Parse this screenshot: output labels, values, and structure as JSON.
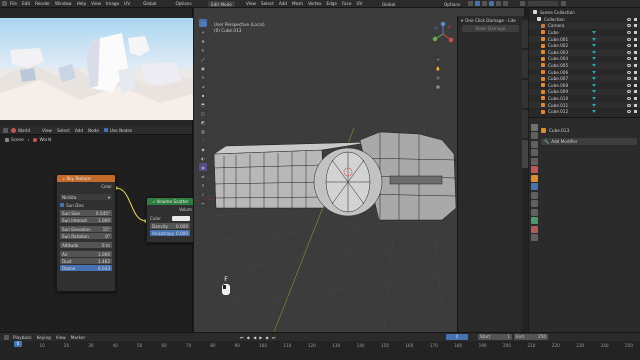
{
  "topbar": {
    "left_menus": [
      "File",
      "Edit",
      "Render",
      "Window",
      "Help"
    ],
    "left_editor_menus": [
      "View",
      "Image",
      "UV"
    ],
    "left_image_label": "Global",
    "left_options": "Options",
    "mode": "Edit Mode",
    "vp_menus": [
      "View",
      "Select",
      "Add",
      "Mesh",
      "Vertex",
      "Edge",
      "Face",
      "UV"
    ],
    "vp_transform": "Global",
    "vp_options": "Options"
  },
  "node_editor": {
    "header": {
      "editor": "World",
      "menus": [
        "View",
        "Select",
        "Add",
        "Node"
      ],
      "use_nodes": "Use Nodes"
    },
    "breadcrumb": {
      "scene": "Scene",
      "world": "World"
    },
    "sky_node": {
      "title": "Sky Texture",
      "output": "Color",
      "type": "Nishita",
      "sun_disc": "Sun Disc",
      "fields": [
        {
          "label": "Sun Size",
          "value": "0.545°"
        },
        {
          "label": "Sun Intensit",
          "value": "1.000"
        },
        {
          "label": "Sun Elevation",
          "value": "15°"
        },
        {
          "label": "Sun Rotation",
          "value": "0°"
        },
        {
          "label": "Altitude",
          "value": "0 m"
        },
        {
          "label": "Air",
          "value": "1.000"
        },
        {
          "label": "Dust",
          "value": "1.462"
        },
        {
          "label": "Ozone",
          "value": "6.033"
        }
      ]
    },
    "vol_node": {
      "title": "Volume Scatter",
      "output": "Volum",
      "color": "Color",
      "fields": [
        {
          "label": "Density",
          "value": "0.000"
        },
        {
          "label": "Anisotropy",
          "value": "0.000"
        }
      ]
    }
  },
  "viewport": {
    "title": "User Perspective (Local)",
    "object": "(0) Cube.013",
    "key_hint": "F"
  },
  "sidebar_addon": {
    "label": "One Click Damage - Lite",
    "button": "Make Damage"
  },
  "outliner": {
    "header": "Scene Collection",
    "items": [
      {
        "name": "Collection",
        "kind": "collection"
      },
      {
        "name": "Camera",
        "kind": "camera"
      },
      {
        "name": "Cube",
        "kind": "mesh"
      },
      {
        "name": "Cube.001",
        "kind": "mesh"
      },
      {
        "name": "Cube.002",
        "kind": "mesh"
      },
      {
        "name": "Cube.003",
        "kind": "mesh"
      },
      {
        "name": "Cube.004",
        "kind": "mesh"
      },
      {
        "name": "Cube.005",
        "kind": "mesh"
      },
      {
        "name": "Cube.006",
        "kind": "mesh"
      },
      {
        "name": "Cube.007",
        "kind": "mesh"
      },
      {
        "name": "Cube.008",
        "kind": "mesh"
      },
      {
        "name": "Cube.009",
        "kind": "mesh"
      },
      {
        "name": "Cube.010",
        "kind": "mesh"
      },
      {
        "name": "Cube.011",
        "kind": "mesh"
      },
      {
        "name": "Cube.012",
        "kind": "mesh"
      }
    ]
  },
  "properties": {
    "object": "Cube.013",
    "add_modifier": "Add Modifier"
  },
  "timeline": {
    "menus": [
      "Playback",
      "Keying",
      "View",
      "Marker"
    ],
    "frame": "0",
    "start_label": "Start",
    "start": "1",
    "end_label": "End",
    "end": "250",
    "ticks": [
      "0",
      "10",
      "20",
      "30",
      "40",
      "50",
      "60",
      "70",
      "80",
      "90",
      "100",
      "110",
      "120",
      "130",
      "140",
      "150",
      "160",
      "170",
      "180",
      "190",
      "200",
      "210",
      "220",
      "230",
      "240",
      "250"
    ]
  },
  "colors": {
    "accent": "#4772b3",
    "sky_header": "#c46b2b",
    "shader_header": "#2e7d3f",
    "selected_outline": "#f2a33a",
    "link_yellow": "#e5d843"
  }
}
